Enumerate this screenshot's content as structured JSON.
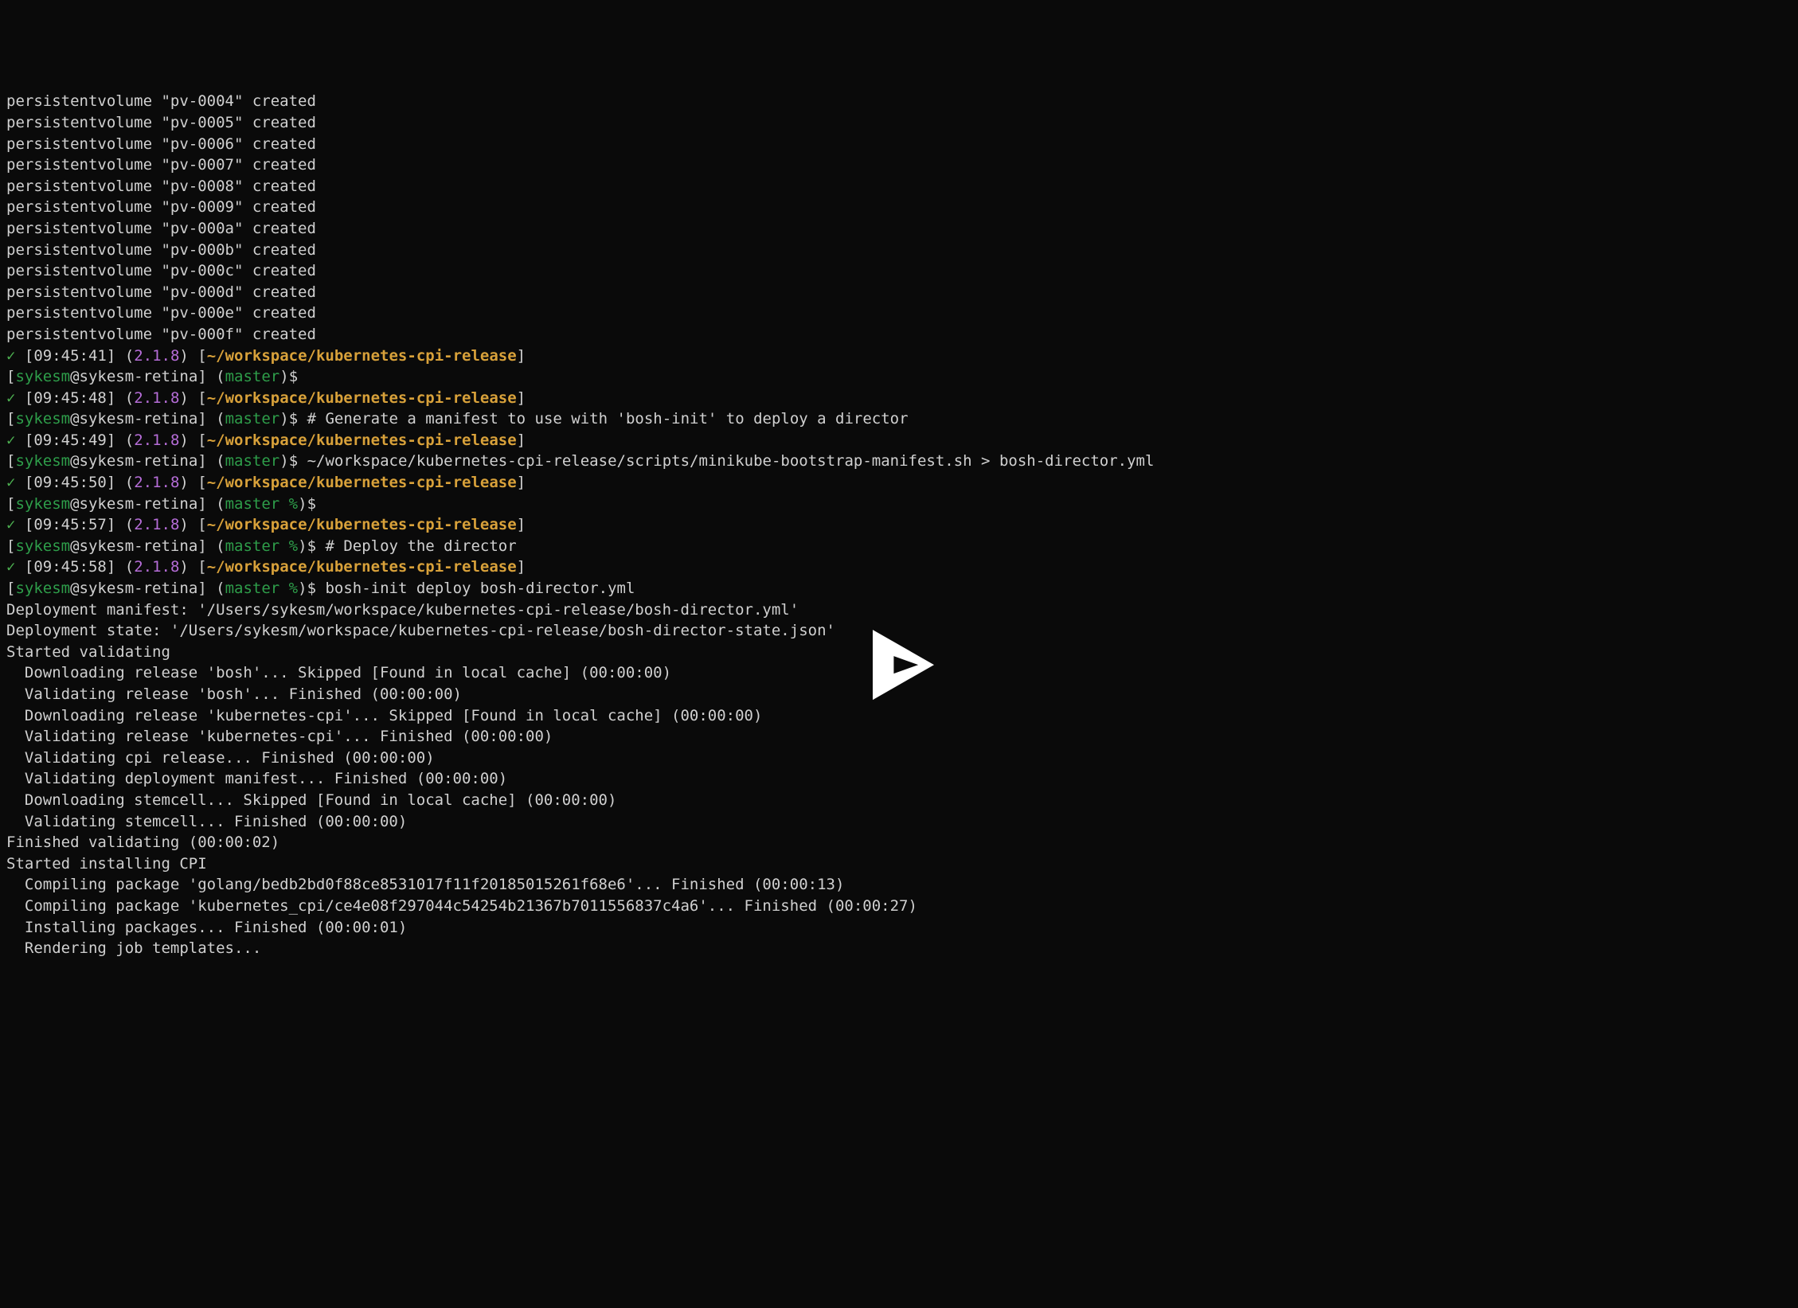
{
  "pv_lines": [
    "persistentvolume \"pv-0004\" created",
    "persistentvolume \"pv-0005\" created",
    "persistentvolume \"pv-0006\" created",
    "persistentvolume \"pv-0007\" created",
    "persistentvolume \"pv-0008\" created",
    "persistentvolume \"pv-0009\" created",
    "persistentvolume \"pv-000a\" created",
    "persistentvolume \"pv-000b\" created",
    "persistentvolume \"pv-000c\" created",
    "persistentvolume \"pv-000d\" created",
    "persistentvolume \"pv-000e\" created",
    "persistentvolume \"pv-000f\" created"
  ],
  "prompts": [
    {
      "time": "09:45:41",
      "ver": "2.1.8",
      "path": "~/workspace/kubernetes-cpi-release",
      "branch": "master",
      "pct": false,
      "cmd": ""
    },
    {
      "time": "09:45:48",
      "ver": "2.1.8",
      "path": "~/workspace/kubernetes-cpi-release",
      "branch": "master",
      "pct": false,
      "cmd": "# Generate a manifest to use with 'bosh-init' to deploy a director"
    },
    {
      "time": "09:45:49",
      "ver": "2.1.8",
      "path": "~/workspace/kubernetes-cpi-release",
      "branch": "master",
      "pct": false,
      "cmd": "~/workspace/kubernetes-cpi-release/scripts/minikube-bootstrap-manifest.sh > bosh-director.yml"
    },
    {
      "time": "09:45:50",
      "ver": "2.1.8",
      "path": "~/workspace/kubernetes-cpi-release",
      "branch": "master",
      "pct": true,
      "cmd": ""
    },
    {
      "time": "09:45:57",
      "ver": "2.1.8",
      "path": "~/workspace/kubernetes-cpi-release",
      "branch": "master",
      "pct": true,
      "cmd": "# Deploy the director"
    },
    {
      "time": "09:45:58",
      "ver": "2.1.8",
      "path": "~/workspace/kubernetes-cpi-release",
      "branch": "master",
      "pct": true,
      "cmd": "bosh-init deploy bosh-director.yml"
    }
  ],
  "user": "sykesm",
  "host": "sykesm-retina",
  "check": "✓",
  "deploy_out": [
    "Deployment manifest: '/Users/sykesm/workspace/kubernetes-cpi-release/bosh-director.yml'",
    "Deployment state: '/Users/sykesm/workspace/kubernetes-cpi-release/bosh-director-state.json'",
    "",
    "Started validating",
    "  Downloading release 'bosh'... Skipped [Found in local cache] (00:00:00)",
    "  Validating release 'bosh'... Finished (00:00:00)",
    "  Downloading release 'kubernetes-cpi'... Skipped [Found in local cache] (00:00:00)",
    "  Validating release 'kubernetes-cpi'... Finished (00:00:00)",
    "  Validating cpi release... Finished (00:00:00)",
    "  Validating deployment manifest... Finished (00:00:00)",
    "  Downloading stemcell... Skipped [Found in local cache] (00:00:00)",
    "  Validating stemcell... Finished (00:00:00)",
    "Finished validating (00:00:02)",
    "",
    "Started installing CPI",
    "  Compiling package 'golang/bedb2bd0f88ce8531017f11f20185015261f68e6'... Finished (00:00:13)",
    "  Compiling package 'kubernetes_cpi/ce4e08f297044c54254b21367b7011556837c4a6'... Finished (00:00:27)",
    "  Installing packages... Finished (00:00:01)",
    "  Rendering job templates..."
  ]
}
